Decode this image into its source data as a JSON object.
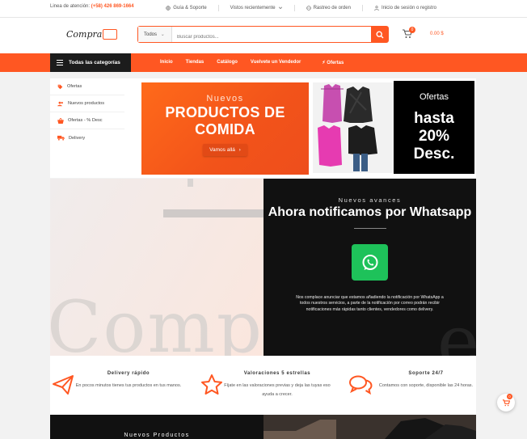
{
  "topbar": {
    "hotline_label": "Linea de atención:",
    "hotline_number": "(+58) 426 869-1664",
    "links": [
      "Guía & Soporte",
      "Vistos recientemente",
      "Rastreo de orden",
      "Inicio de sesión o registro"
    ]
  },
  "header": {
    "logo_text": "Compra",
    "search": {
      "category": "Todos",
      "placeholder": "Buscar productos..."
    },
    "cart": {
      "count": "0",
      "total": "0.00 $"
    }
  },
  "nav": {
    "all_categories": "Todas las categorías",
    "items": [
      "Inicio",
      "Tiendas",
      "Catálogo",
      "Vuelvete un Vendedor",
      "Ofertas"
    ]
  },
  "sidebar": {
    "items": [
      "Ofertas",
      "Nuevos productos",
      "Ofertas - % Desc",
      "Delivery"
    ]
  },
  "promos": {
    "food": {
      "eyebrow": "Nuevos",
      "title": "PRODUCTOS DE COMIDA",
      "cta": "Vamos allá"
    },
    "offers": {
      "line1": "Ofertas",
      "line2": "hasta",
      "line3": "20%",
      "line4": "Desc."
    }
  },
  "hero": {
    "watermark": "Compra",
    "eyebrow": "Nuevos avances",
    "title": "Ahora notificamos por Whatsapp",
    "description": "Nos complace anunciar que estamos añadiendo la notificación por WhatsApp a todos nuestros servicios, a parte de la notificación por correo podrán recibir notificaciones más rápidas tanto clientes, vendedores como delivery."
  },
  "features": [
    {
      "title": "Delivery rápido",
      "desc": "En pocos minutos tienes tus productos en tus manos."
    },
    {
      "title": "Valoraciones 5 estrellas",
      "desc": "Fíjate en las valoraciones previas y deja las tuyas eso ayuda a crecer."
    },
    {
      "title": "Soporte 24/7",
      "desc": "Contamos con soporte, disponible las 24 horas."
    }
  ],
  "bottom": {
    "left_title": "Nuevos Productos"
  },
  "float_cart": {
    "count": "0"
  },
  "colors": {
    "accent": "#ff5722",
    "dark": "#111111",
    "whatsapp": "#1ec25a"
  }
}
